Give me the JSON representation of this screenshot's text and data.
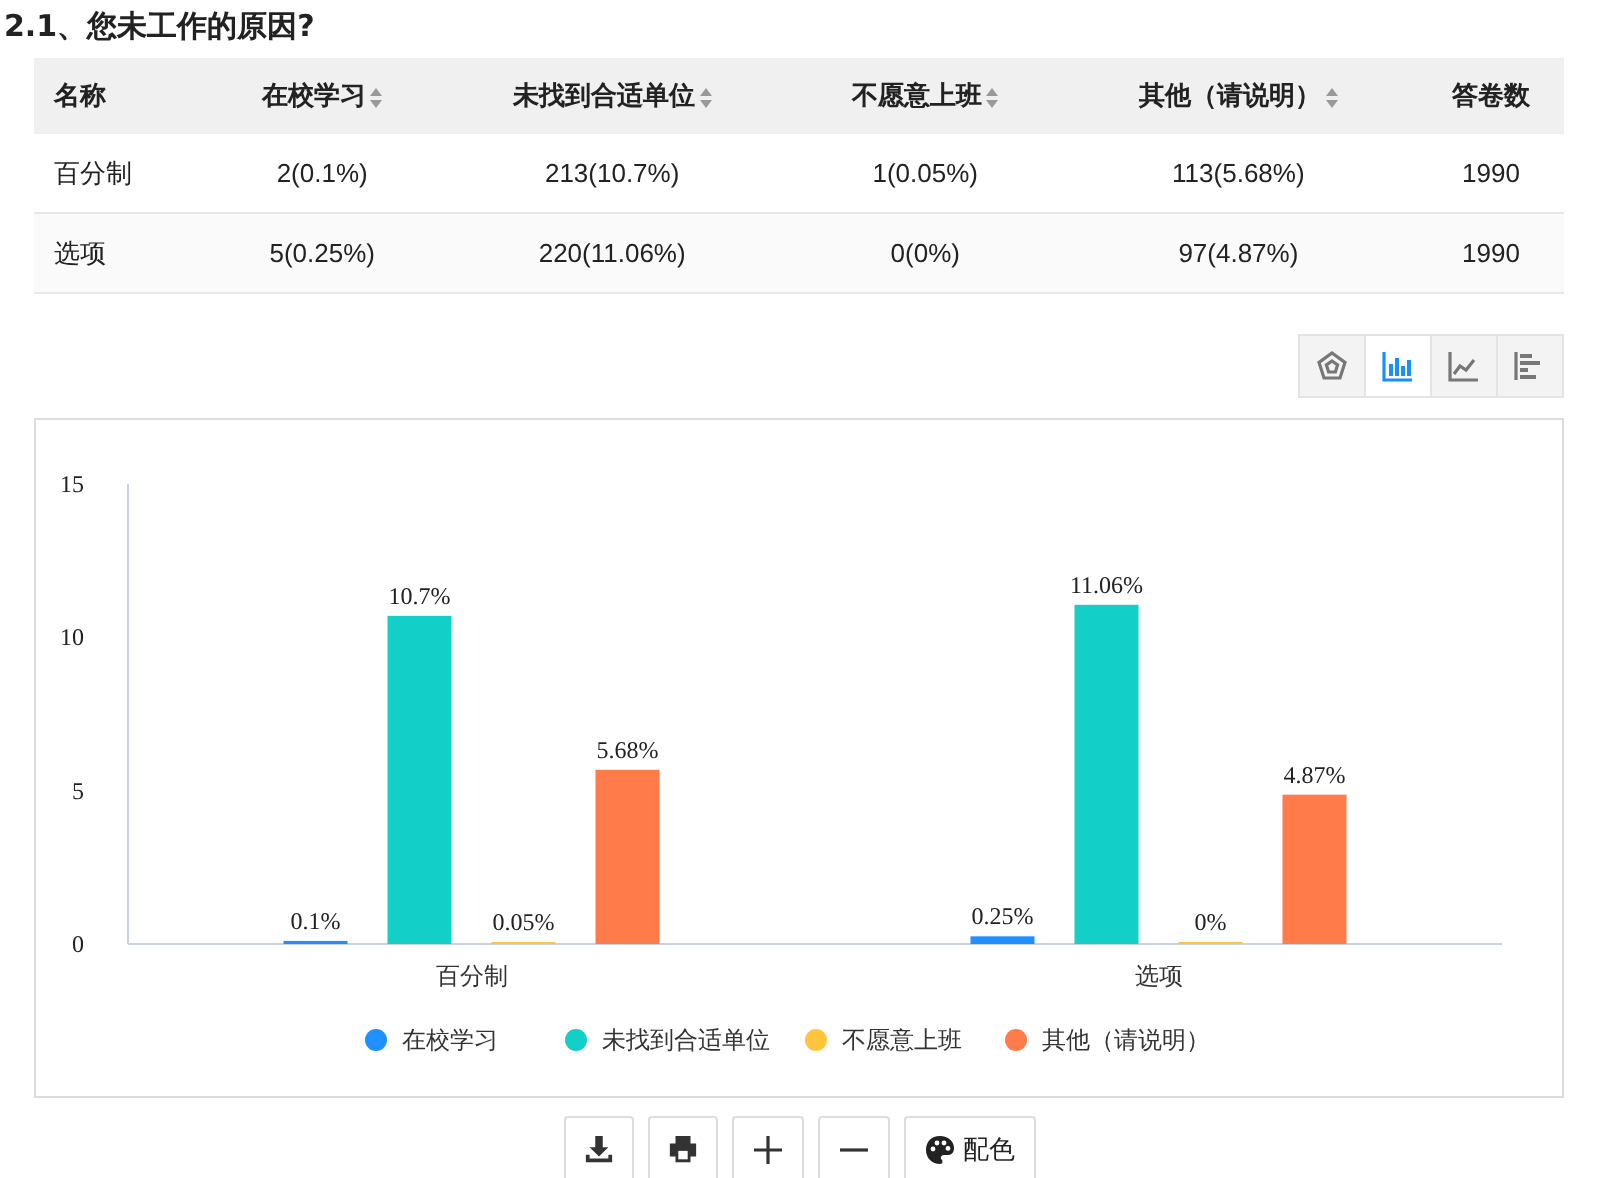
{
  "title": "2.1、您未工作的原因?",
  "table": {
    "columns": [
      {
        "label": "名称",
        "sortable": false
      },
      {
        "label": "在校学习",
        "sortable": true
      },
      {
        "label": "未找到合适单位",
        "sortable": true
      },
      {
        "label": "不愿意上班",
        "sortable": true
      },
      {
        "label": "其他（请说明）",
        "sortable": true
      },
      {
        "label": "答卷数",
        "sortable": false
      }
    ],
    "rows": [
      [
        "百分制",
        "2(0.1%)",
        "213(10.7%)",
        "1(0.05%)",
        "113(5.68%)",
        "1990"
      ],
      [
        "选项",
        "5(0.25%)",
        "220(11.06%)",
        "0(0%)",
        "97(4.87%)",
        "1990"
      ]
    ]
  },
  "chart_types": [
    {
      "kind": "radar",
      "selected": false
    },
    {
      "kind": "bar",
      "selected": true
    },
    {
      "kind": "line",
      "selected": false
    },
    {
      "kind": "hbar",
      "selected": false
    }
  ],
  "chart_data": {
    "type": "bar",
    "legend": "bottom",
    "categories": [
      "百分制",
      "选项"
    ],
    "ylim": [
      0,
      15
    ],
    "yticks": [
      0,
      5,
      10,
      15
    ],
    "value_labels": [
      [
        "0.1%",
        "0.25%"
      ],
      [
        "10.7%",
        "11.06%"
      ],
      [
        "0.05%",
        "0%"
      ],
      [
        "5.68%",
        "4.87%"
      ]
    ],
    "series": [
      {
        "name": "在校学习",
        "color": "#1e90ff",
        "values": [
          0.1,
          0.25
        ]
      },
      {
        "name": "未找到合适单位",
        "color": "#12cfc8",
        "values": [
          10.7,
          11.06
        ]
      },
      {
        "name": "不愿意上班",
        "color": "#ffc53d",
        "values": [
          0.05,
          0
        ]
      },
      {
        "name": "其他（请说明）",
        "color": "#ff7b4a",
        "values": [
          5.68,
          4.87
        ]
      }
    ]
  },
  "toolbar": [
    {
      "kind": "download"
    },
    {
      "kind": "print"
    },
    {
      "kind": "zoom-in"
    },
    {
      "kind": "zoom-out"
    },
    {
      "kind": "palette",
      "label": "配色"
    }
  ]
}
